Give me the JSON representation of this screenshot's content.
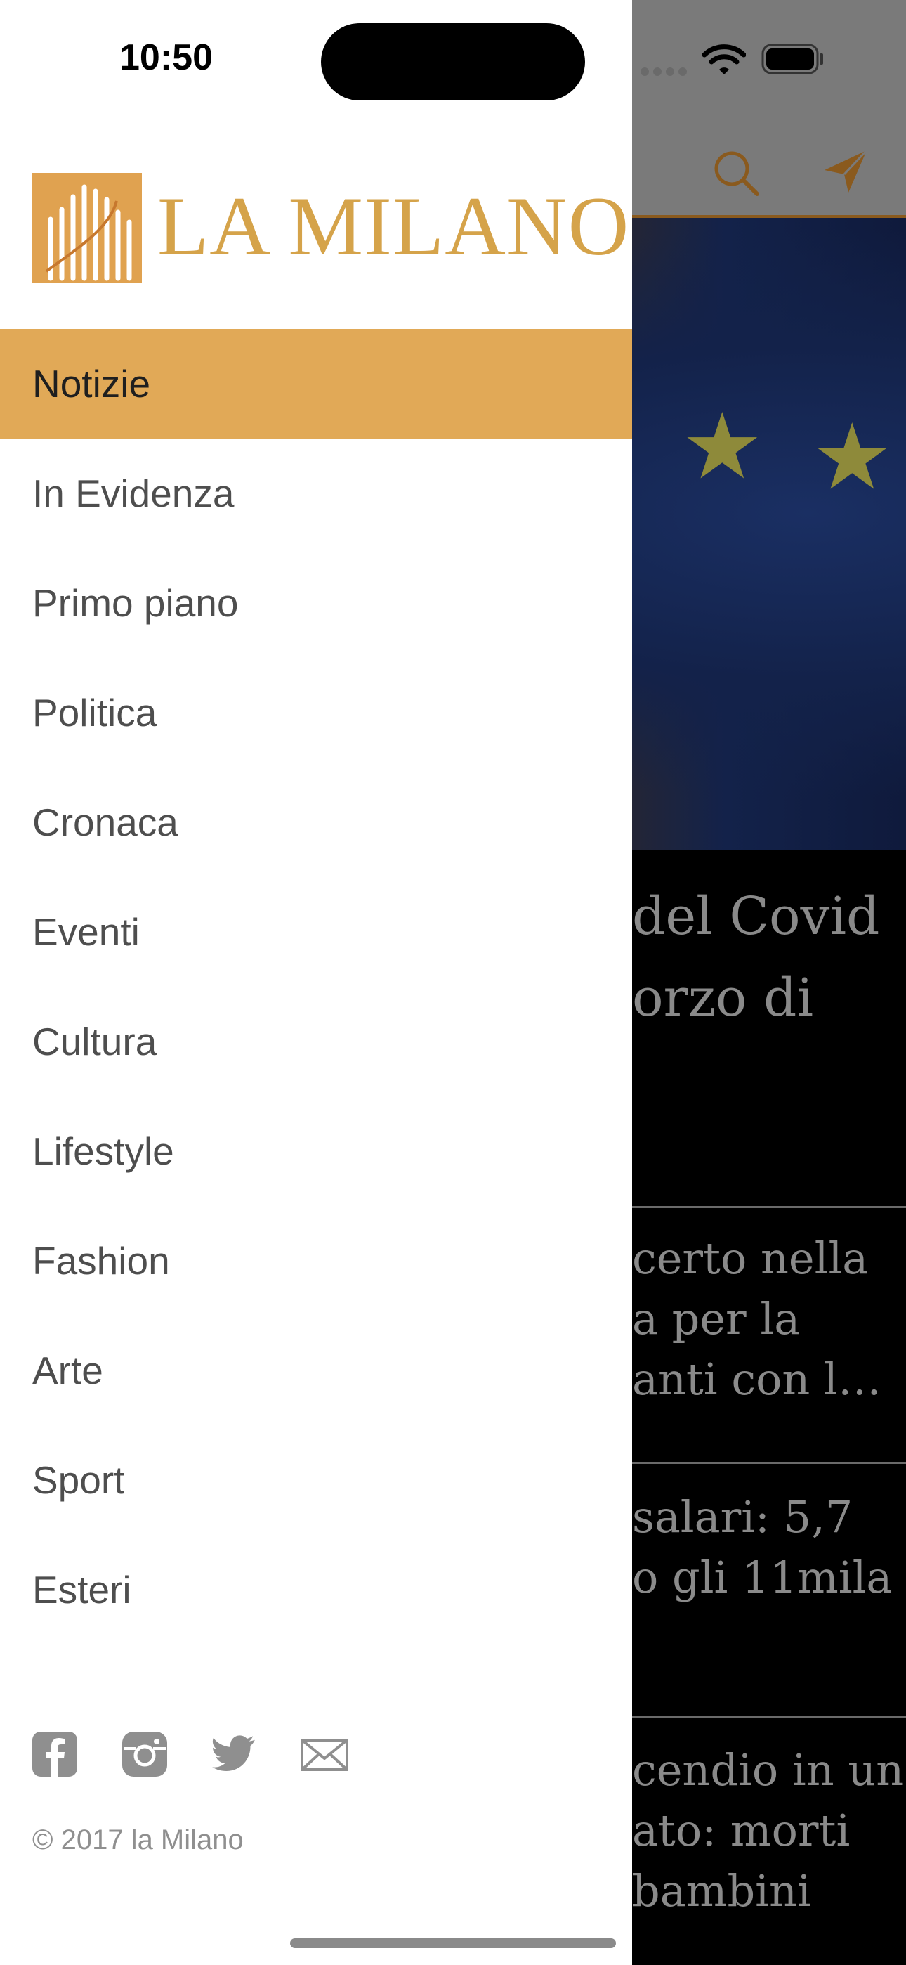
{
  "status_bar": {
    "time": "10:50"
  },
  "brand": {
    "name": "LA MILANO",
    "accent": "#e1a957"
  },
  "menu": {
    "active_index": 0,
    "items": [
      {
        "label": "Notizie"
      },
      {
        "label": "In Evidenza"
      },
      {
        "label": "Primo piano"
      },
      {
        "label": "Politica"
      },
      {
        "label": "Cronaca"
      },
      {
        "label": "Eventi"
      },
      {
        "label": "Cultura"
      },
      {
        "label": "Lifestyle"
      },
      {
        "label": "Fashion"
      },
      {
        "label": "Arte"
      },
      {
        "label": "Sport"
      },
      {
        "label": "Esteri"
      }
    ]
  },
  "social": [
    "facebook-icon",
    "instagram-icon",
    "twitter-icon",
    "mail-icon"
  ],
  "footer": {
    "copyright": "© 2017 la Milano"
  },
  "background": {
    "headline_lines": [
      "del Covid",
      "orzo di"
    ],
    "articles": [
      {
        "lines": [
          "certo nella",
          "a per la",
          "anti con l…"
        ]
      },
      {
        "lines": [
          "salari: 5,7",
          "o gli 11mila"
        ]
      },
      {
        "lines": [
          "cendio in un",
          "ato: morti",
          " bambini"
        ]
      }
    ]
  }
}
